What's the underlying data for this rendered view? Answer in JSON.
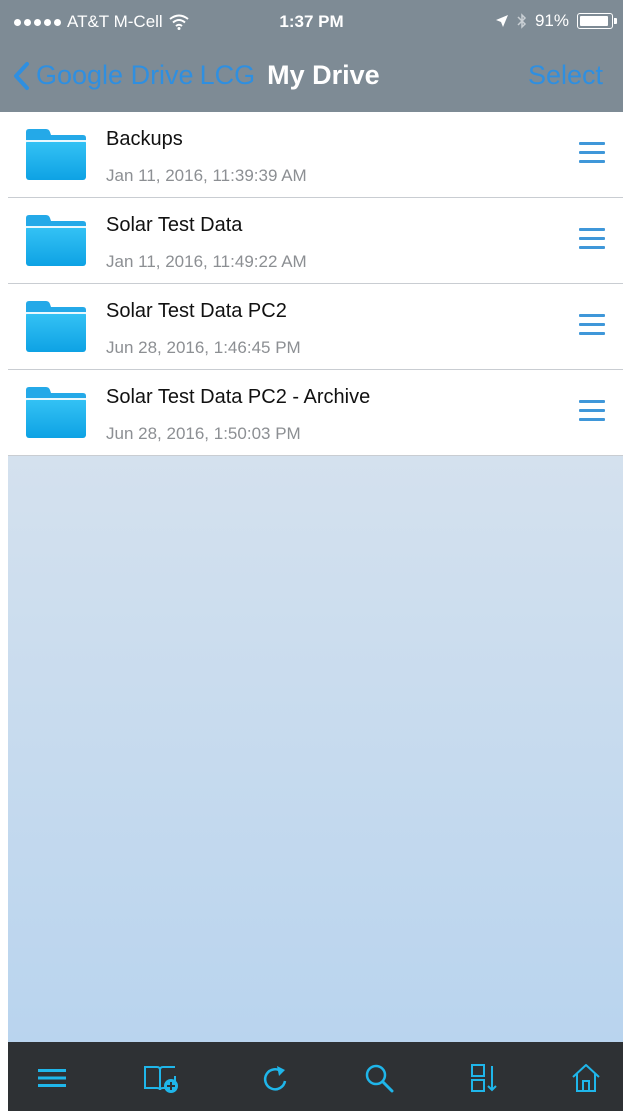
{
  "status_bar": {
    "carrier": "AT&T M-Cell",
    "time": "1:37 PM",
    "battery": "91%"
  },
  "nav": {
    "back_label": "Google Drive",
    "breadcrumb": "LCG",
    "title": "My Drive",
    "select_label": "Select"
  },
  "files": [
    {
      "name": "Backups",
      "date": "Jan 11, 2016, 11:39:39 AM"
    },
    {
      "name": "Solar Test Data",
      "date": "Jan 11, 2016, 11:49:22 AM"
    },
    {
      "name": "Solar Test Data PC2",
      "date": "Jun 28, 2016, 1:46:45 PM"
    },
    {
      "name": "Solar Test Data PC2 - Archive",
      "date": "Jun 28, 2016, 1:50:03 PM"
    }
  ],
  "toolbar": {
    "icons": [
      "menu-icon",
      "new-folder-icon",
      "refresh-icon",
      "search-icon",
      "sort-icon",
      "home-icon"
    ]
  },
  "colors": {
    "accent": "#2f8fe0",
    "toolbar_icon": "#1fb6ea",
    "nav_bg": "#7e8b95",
    "toolbar_bg": "#2e3134"
  }
}
